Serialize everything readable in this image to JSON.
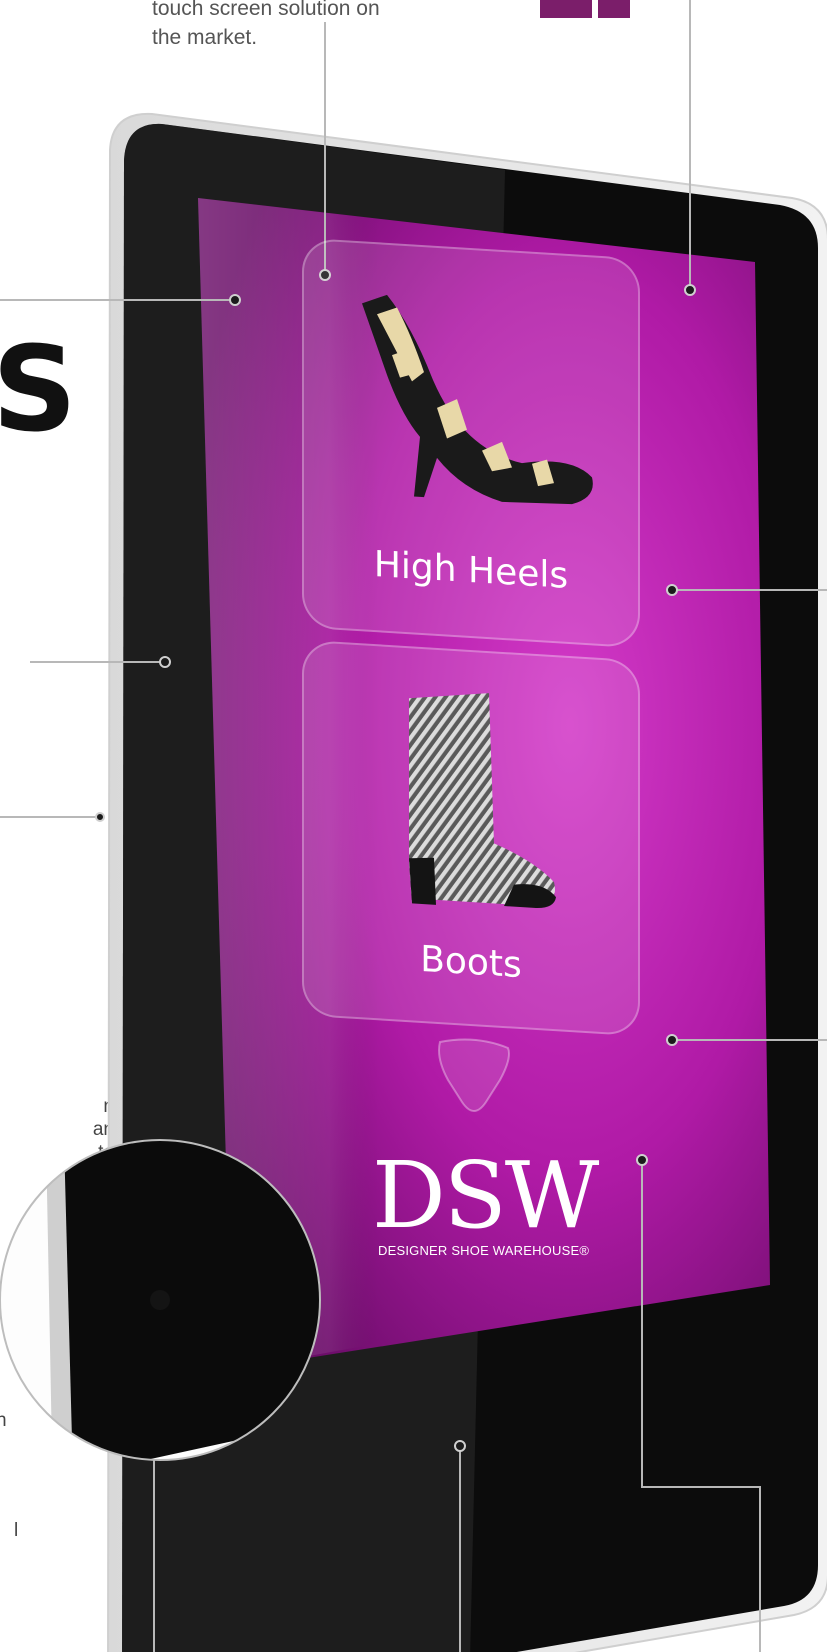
{
  "top_caption": {
    "line1": "touch screen solution on",
    "line2": "the market."
  },
  "side_heading_fragment": "S",
  "left_text_fragments": [
    "n",
    "an",
    "to",
    "to"
  ],
  "left_fragment_n": "n",
  "left_fragment_l": "l",
  "kiosk": {
    "tiles": [
      {
        "label": "High Heels",
        "icon": "high-heel-shoe-image"
      },
      {
        "label": "Boots",
        "icon": "boot-image"
      }
    ],
    "scroll_icon": "down-triangle-icon",
    "brand": {
      "name": "DSW",
      "tagline": "DESIGNER SHOE WAREHOUSE®"
    }
  },
  "colors": {
    "screen": "#c020b0",
    "bezel": "#0d0d0d",
    "callout_line": "#b8b8b8"
  }
}
